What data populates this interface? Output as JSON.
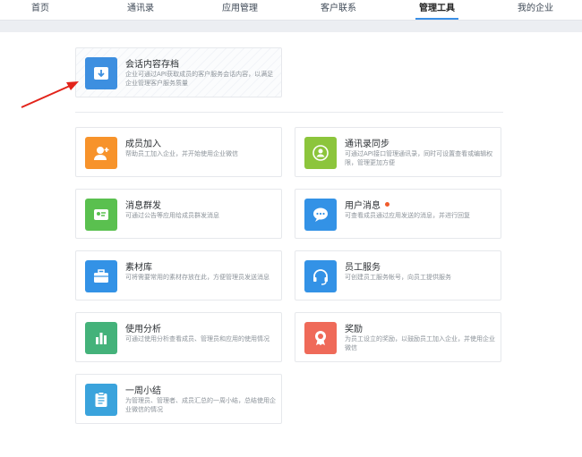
{
  "nav": {
    "items": [
      {
        "label": "首页",
        "active": false
      },
      {
        "label": "通讯录",
        "active": false
      },
      {
        "label": "应用管理",
        "active": false
      },
      {
        "label": "客户联系",
        "active": false
      },
      {
        "label": "管理工具",
        "active": true
      },
      {
        "label": "我的企业",
        "active": false
      }
    ]
  },
  "featured": {
    "title": "会话内容存档",
    "desc": "企业可通过API获取成员的客户服务会话内容，以满足企业管理客户服务质量",
    "icon": "archive-download-icon",
    "color": "#3d8fe0"
  },
  "tools": [
    {
      "title": "成员加入",
      "desc": "帮助员工加入企业，并开始使用企业微信",
      "icon": "person-add-icon",
      "color": "#f7932b",
      "badge": false
    },
    {
      "title": "通讯录同步",
      "desc": "可通过API接口管理通讯录，同时可设置查看或编辑权限，管理更加方便",
      "icon": "contact-sync-icon",
      "color": "#8cc53c",
      "badge": false
    },
    {
      "title": "消息群发",
      "desc": "可通过公告等应用给成员群发消息",
      "icon": "broadcast-message-icon",
      "color": "#5ac04f",
      "badge": false
    },
    {
      "title": "用户消息",
      "desc": "可查看成员通过应用发送的消息，并进行回复",
      "icon": "chat-bubble-icon",
      "color": "#3392e6",
      "badge": true
    },
    {
      "title": "素材库",
      "desc": "可将需要常用的素材存放在此，方便管理员发送消息",
      "icon": "briefcase-icon",
      "color": "#3392e6",
      "badge": false
    },
    {
      "title": "员工服务",
      "desc": "可创建员工服务帐号，向员工提供服务",
      "icon": "headset-icon",
      "color": "#3392e6",
      "badge": false
    },
    {
      "title": "使用分析",
      "desc": "可通过使用分析查看成员、管理员和应用的使用情况",
      "icon": "bar-chart-icon",
      "color": "#44b27a",
      "badge": false
    },
    {
      "title": "奖励",
      "desc": "为员工设立的奖励，以鼓励员工加入企业，并使用企业微信",
      "icon": "award-medal-icon",
      "color": "#ef6a59",
      "badge": false
    },
    {
      "title": "一周小结",
      "desc": "为管理员、管理者、成员汇总的一周小结，总结使用企业微信的情况",
      "icon": "clipboard-icon",
      "color": "#3aa3dc",
      "badge": false
    }
  ]
}
